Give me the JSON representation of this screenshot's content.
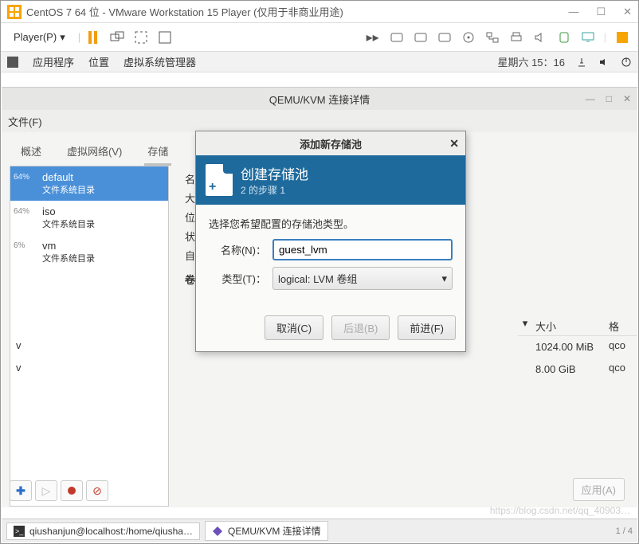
{
  "vmware": {
    "title": "CentOS 7 64 位 - VMware Workstation 15 Player (仅用于非商业用途)",
    "player_menu": "Player(P)"
  },
  "gnome": {
    "apps": "应用程序",
    "places": "位置",
    "vm_mgr": "虚拟系统管理器",
    "clock": "星期六 15：16"
  },
  "qemu": {
    "title": "QEMU/KVM 连接详情",
    "file_menu": "文件(F)",
    "tabs": {
      "overview": "概述",
      "vnet": "虚拟网络(V)",
      "storage": "存储"
    },
    "pools": [
      {
        "pct": "64%",
        "name": "default",
        "sub": "文件系统目录"
      },
      {
        "pct": "64%",
        "name": "iso",
        "sub": "文件系统目录"
      },
      {
        "pct": "6%",
        "name": "vm",
        "sub": "文件系统目录"
      }
    ],
    "right_labels": {
      "name": "名",
      "big": "大",
      "loc": "位",
      "state": "状",
      "auto": "自",
      "vol": "卷"
    },
    "table": {
      "arrow_col": "▾",
      "size_hdr": "大小",
      "fmt_hdr": "格",
      "rows": [
        {
          "v": "v",
          "size": "1024.00 MiB",
          "fmt": "qco"
        },
        {
          "v": "v",
          "size": "8.00 GiB",
          "fmt": "qco"
        }
      ]
    },
    "apply": "应用(A)"
  },
  "dialog": {
    "title": "添加新存储池",
    "banner_title": "创建存储池",
    "banner_step": "2 的步骤 1",
    "prompt": "选择您希望配置的存储池类型。",
    "name_label": "名称(N)：",
    "name_value": "guest_lvm",
    "type_label": "类型(T)：",
    "type_value": "logical: LVM 卷组",
    "cancel": "取消(C)",
    "back": "后退(B)",
    "forward": "前进(F)"
  },
  "taskbar": {
    "term": "qiushanjun@localhost:/home/qiusha…",
    "qemu": "QEMU/KVM 连接详情",
    "pager": "1 / 4"
  },
  "watermark": "https://blog.csdn.net/qq_40903…"
}
